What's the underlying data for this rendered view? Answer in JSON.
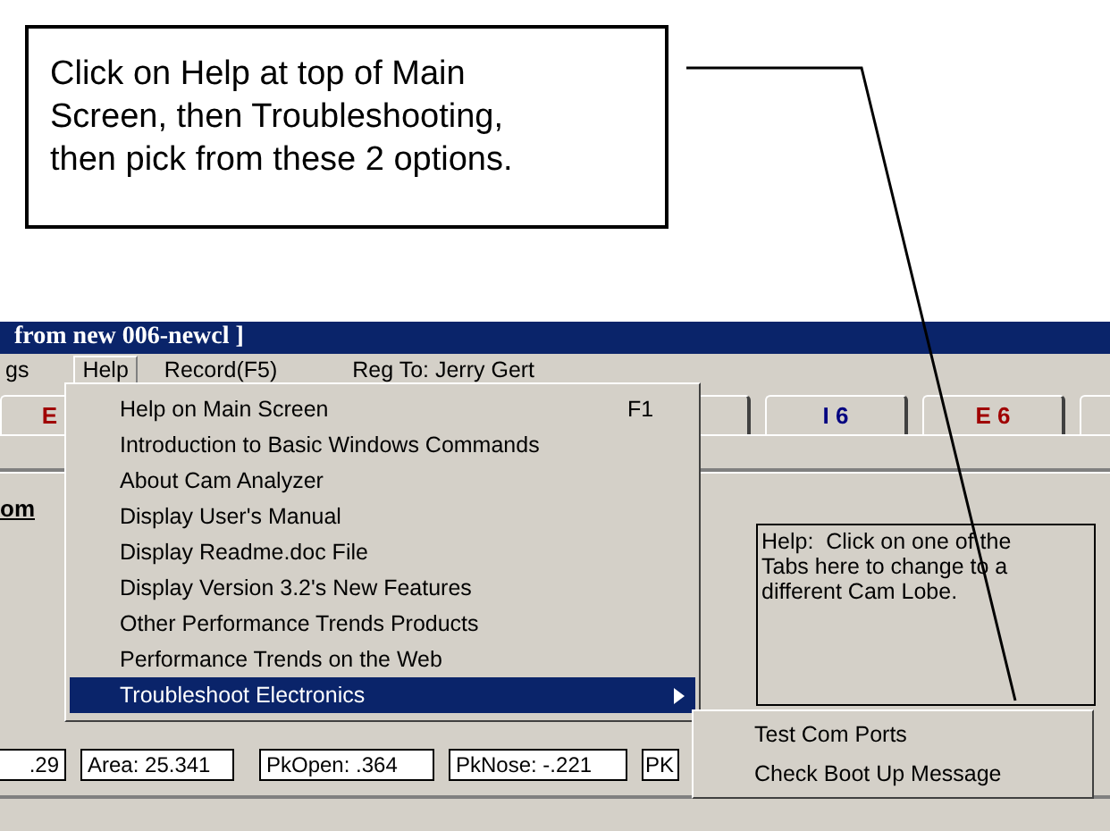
{
  "callout": {
    "text": "Click on Help at top of Main Screen, then Troubleshooting, then pick from these 2 options."
  },
  "window": {
    "title": "from new 006-newcl ]"
  },
  "menu_bar": [
    {
      "label": "gs",
      "open": false
    },
    {
      "label": "Help",
      "open": true
    },
    {
      "label": "Record(F5)",
      "open": false
    },
    {
      "label": "Reg To: Jerry Gert",
      "open": false
    }
  ],
  "tabs": [
    {
      "label": "E",
      "color": "#a00000"
    },
    {
      "label": "I 6",
      "color": "#000080"
    },
    {
      "label": "E 6",
      "color": "#a00000"
    }
  ],
  "section_label": "om",
  "help_box": {
    "text": "Help:  Click on one of the Tabs here to change to a different Cam Lobe."
  },
  "readouts": [
    ".29",
    "Area: 25.341",
    "PkOpen: .364",
    "PkNose: -.221",
    "PK"
  ],
  "help_menu": {
    "items": [
      {
        "label": "Help on Main Screen",
        "shortcut": "F1",
        "selected": false,
        "submenu": false
      },
      {
        "label": "Introduction to Basic Windows Commands",
        "selected": false,
        "submenu": false
      },
      {
        "label": "About Cam Analyzer",
        "selected": false,
        "submenu": false
      },
      {
        "label": "Display User's Manual",
        "selected": false,
        "submenu": false
      },
      {
        "label": "Display Readme.doc File",
        "selected": false,
        "submenu": false
      },
      {
        "label": "Display Version 3.2's New Features",
        "selected": false,
        "submenu": false
      },
      {
        "label": "Other Performance Trends Products",
        "selected": false,
        "submenu": false
      },
      {
        "label": "Performance Trends on the Web",
        "selected": false,
        "submenu": false
      },
      {
        "label": "Troubleshoot Electronics",
        "selected": true,
        "submenu": true
      }
    ]
  },
  "submenu": {
    "items": [
      "Test Com Ports",
      "Check Boot Up Message"
    ]
  }
}
